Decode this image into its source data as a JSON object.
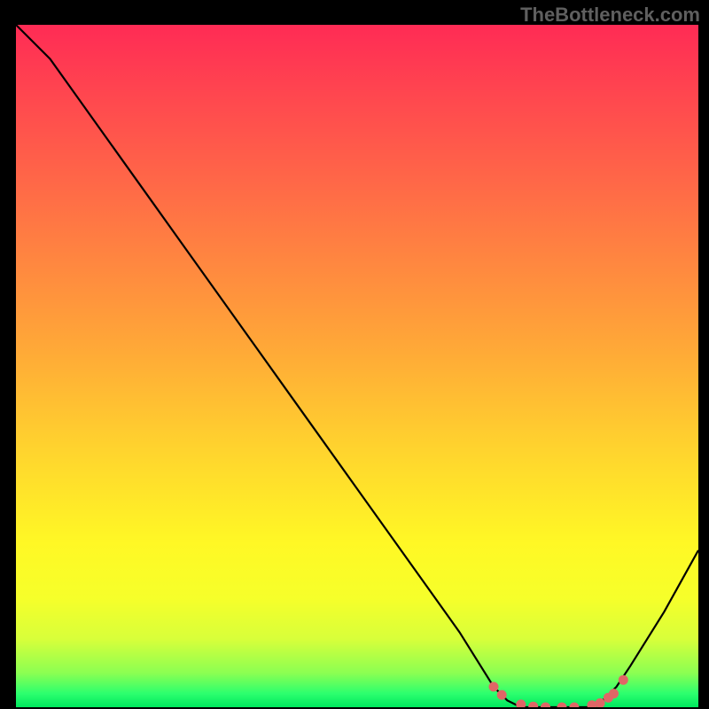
{
  "watermark": "TheBottleneck.com",
  "chart_data": {
    "type": "line",
    "title": "",
    "xlabel": "",
    "ylabel": "",
    "series": [
      {
        "name": "curve",
        "x": [
          0.0,
          0.05,
          0.1,
          0.15,
          0.2,
          0.25,
          0.3,
          0.35,
          0.4,
          0.45,
          0.5,
          0.55,
          0.6,
          0.65,
          0.7,
          0.72,
          0.74,
          0.76,
          0.78,
          0.8,
          0.82,
          0.84,
          0.86,
          0.88,
          0.9,
          0.95,
          1.0
        ],
        "y": [
          1.0,
          0.95,
          0.88,
          0.81,
          0.74,
          0.67,
          0.6,
          0.53,
          0.46,
          0.39,
          0.32,
          0.25,
          0.18,
          0.11,
          0.03,
          0.01,
          0.0,
          0.0,
          0.0,
          0.0,
          0.0,
          0.0,
          0.01,
          0.03,
          0.06,
          0.14,
          0.23
        ]
      },
      {
        "name": "markers",
        "x": [
          0.7,
          0.712,
          0.74,
          0.758,
          0.776,
          0.8,
          0.818,
          0.844,
          0.856,
          0.868,
          0.876,
          0.89
        ],
        "y": [
          0.03,
          0.018,
          0.004,
          0.001,
          0.0,
          0.0,
          0.0,
          0.003,
          0.006,
          0.014,
          0.02,
          0.04
        ]
      }
    ],
    "xlim": [
      0,
      1
    ],
    "ylim": [
      0,
      1
    ],
    "gradient_stops": [
      {
        "pos": 0.0,
        "color": "#ff2b55"
      },
      {
        "pos": 0.24,
        "color": "#ff6a47"
      },
      {
        "pos": 0.48,
        "color": "#ffaa37"
      },
      {
        "pos": 0.76,
        "color": "#fff825"
      },
      {
        "pos": 0.95,
        "color": "#8bff52"
      },
      {
        "pos": 1.0,
        "color": "#00e85e"
      }
    ],
    "curve_color": "#000000",
    "marker_color": "#e06666"
  }
}
